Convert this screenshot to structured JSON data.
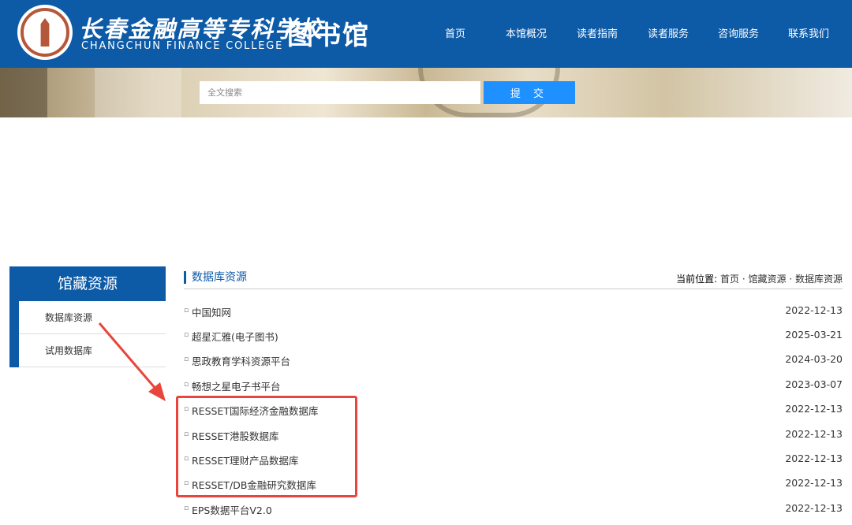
{
  "header": {
    "school_name_cn": "长春金融高等专科学校",
    "school_name_en": "CHANGCHUN FINANCE COLLEGE",
    "library_title": "图书馆",
    "logo_icon": "college-seal-icon"
  },
  "nav": {
    "items": [
      {
        "label": "首页"
      },
      {
        "label": "本馆概况"
      },
      {
        "label": "读者指南"
      },
      {
        "label": "读者服务"
      },
      {
        "label": "咨询服务"
      },
      {
        "label": "联系我们"
      }
    ]
  },
  "search": {
    "placeholder": "全文搜索",
    "submit_label": "提 交"
  },
  "sidebar": {
    "heading": "馆藏资源",
    "items": [
      {
        "label": "数据库资源"
      },
      {
        "label": "试用数据库"
      }
    ]
  },
  "main": {
    "section_title": "数据库资源",
    "breadcrumb": {
      "label": "当前位置:",
      "parts": [
        "首页",
        "馆藏资源",
        "数据库资源"
      ],
      "separator": " · "
    },
    "rows": [
      {
        "name": "中国知网",
        "date": "2022-12-13"
      },
      {
        "name": "超星汇雅(电子图书)",
        "date": "2025-03-21"
      },
      {
        "name": "思政教育学科资源平台",
        "date": "2024-03-20"
      },
      {
        "name": "畅想之星电子书平台",
        "date": "2023-03-07"
      },
      {
        "name": "RESSET国际经济金融数据库",
        "date": "2022-12-13"
      },
      {
        "name": "RESSET港股数据库",
        "date": "2022-12-13"
      },
      {
        "name": "RESSET理财产品数据库",
        "date": "2022-12-13"
      },
      {
        "name": "RESSET/DB金融研究数据库",
        "date": "2022-12-13"
      },
      {
        "name": "EPS数据平台V2.0",
        "date": "2022-12-13"
      }
    ]
  },
  "colors": {
    "brand_blue": "#0d5aa7",
    "button_blue": "#1e90ff",
    "annotation_red": "#e8453c"
  }
}
